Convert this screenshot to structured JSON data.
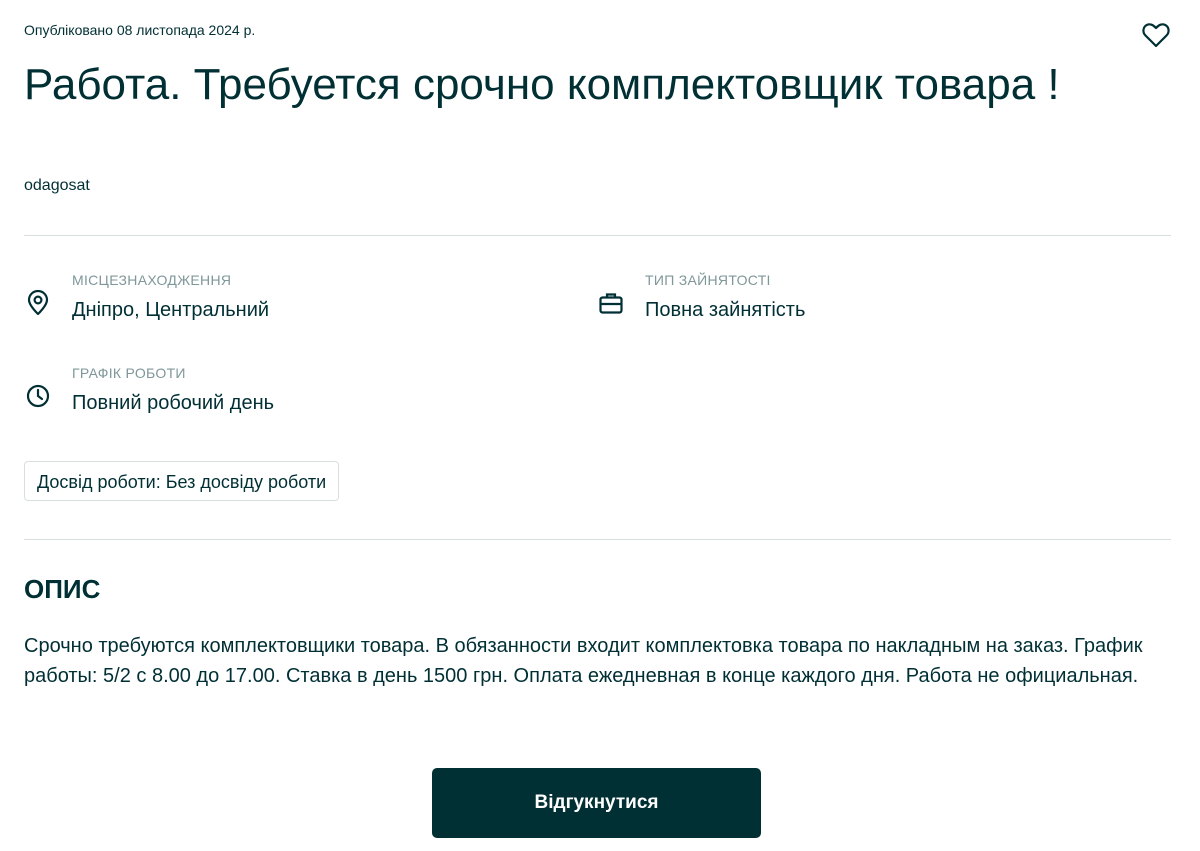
{
  "header": {
    "published": "Опубліковано 08 листопада 2024 р.",
    "favorite_icon": "heart-icon"
  },
  "ad": {
    "title": "Работа. Требуется срочно комплектовщик товара !",
    "author": "odagosat"
  },
  "params": {
    "location": {
      "label": "МІСЦЕЗНАХОДЖЕННЯ",
      "value": "Дніпро, Центральний",
      "icon": "location-pin-icon"
    },
    "employment_type": {
      "label": "ТИП ЗАЙНЯТОСТІ",
      "value": "Повна зайнятість",
      "icon": "briefcase-icon"
    },
    "schedule": {
      "label": "ГРАФІК РОБОТИ",
      "value": "Повний робочий день",
      "icon": "clock-icon"
    }
  },
  "tags": {
    "experience": "Досвід роботи: Без досвіду роботи"
  },
  "description": {
    "heading": "ОПИС",
    "text": "Срочно требуются комплектовщики товара. В обязанности входит комплектовка товара по накладным на заказ. График работы: 5/2 с 8.00 до 17.00. Ставка в день 1500 грн. Оплата ежедневная в конце каждого дня. Работа не официальная."
  },
  "actions": {
    "apply_label": "Відгукнутися"
  },
  "colors": {
    "primary": "#002f34",
    "muted": "#7f9799",
    "border": "#d8dfe0"
  }
}
